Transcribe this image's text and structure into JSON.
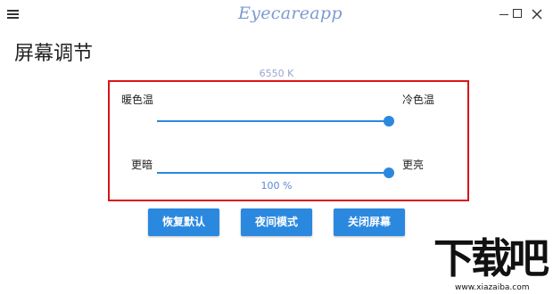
{
  "app": {
    "logo_text": "Eyecareapp"
  },
  "window_controls": {
    "minimize": "minimize",
    "maximize": "maximize",
    "close": "close"
  },
  "page": {
    "title": "屏幕调节"
  },
  "temperature": {
    "readout": "6550 K",
    "label_warm": "暖色温",
    "label_cool": "冷色温",
    "level": 1.0
  },
  "brightness": {
    "label_dark": "更暗",
    "label_bright": "更亮",
    "readout": "100 %",
    "level": 1.0
  },
  "buttons": {
    "restore_default": "恢复默认",
    "night_mode": "夜间模式",
    "close_screen": "关闭屏幕"
  },
  "watermark": {
    "chars": "下载吧",
    "url": "www.xiazaiba.com"
  },
  "colors": {
    "accent": "#2b88df",
    "highlight_border": "#d9141b",
    "logo": "#7b9bd2"
  },
  "icons": {
    "menu": "hamburger-menu-icon",
    "close": "close-icon"
  }
}
